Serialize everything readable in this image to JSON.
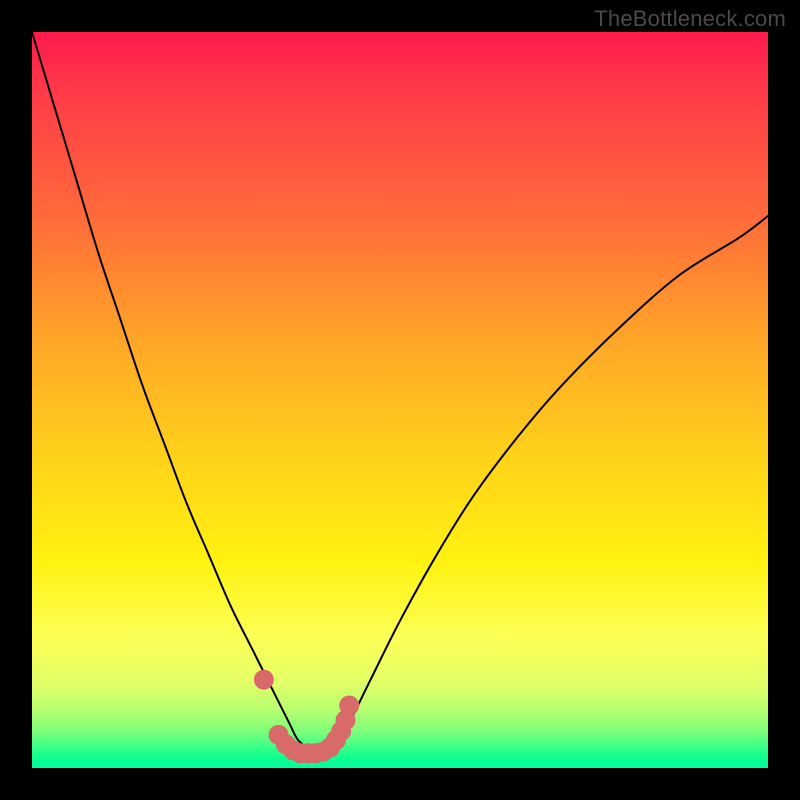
{
  "watermark": "TheBottleneck.com",
  "chart_data": {
    "type": "line",
    "title": "",
    "xlabel": "",
    "ylabel": "",
    "xlim": [
      0,
      100
    ],
    "ylim": [
      0,
      100
    ],
    "grid": false,
    "legend": false,
    "annotations": [],
    "series": [
      {
        "name": "bottleneck-curve",
        "color": "#000000",
        "stroke_width": 2,
        "x": [
          0,
          3,
          6,
          9,
          12,
          15,
          18,
          21,
          24,
          27,
          30,
          33,
          35,
          36,
          37,
          38,
          39,
          40,
          41,
          43,
          46,
          50,
          55,
          60,
          66,
          72,
          80,
          88,
          96,
          100
        ],
        "y": [
          100,
          90,
          80,
          70,
          61,
          52,
          44,
          36,
          29,
          22,
          16,
          10,
          6,
          4,
          3,
          2,
          2,
          2,
          3,
          6,
          12,
          20,
          29,
          37,
          45,
          52,
          60,
          67,
          72,
          75
        ]
      },
      {
        "name": "highlight-dots",
        "color": "#d86a6a",
        "marker": "circle",
        "marker_size": 10,
        "x": [
          31.5,
          33.5,
          34.5,
          35.5,
          36.5,
          37.5,
          38.5,
          39.5,
          40.5,
          41.3,
          42.0,
          42.6,
          43.1
        ],
        "y": [
          12,
          4.5,
          3.2,
          2.4,
          2.0,
          2.0,
          2.0,
          2.2,
          2.8,
          3.8,
          5.0,
          6.5,
          8.5
        ]
      }
    ]
  }
}
